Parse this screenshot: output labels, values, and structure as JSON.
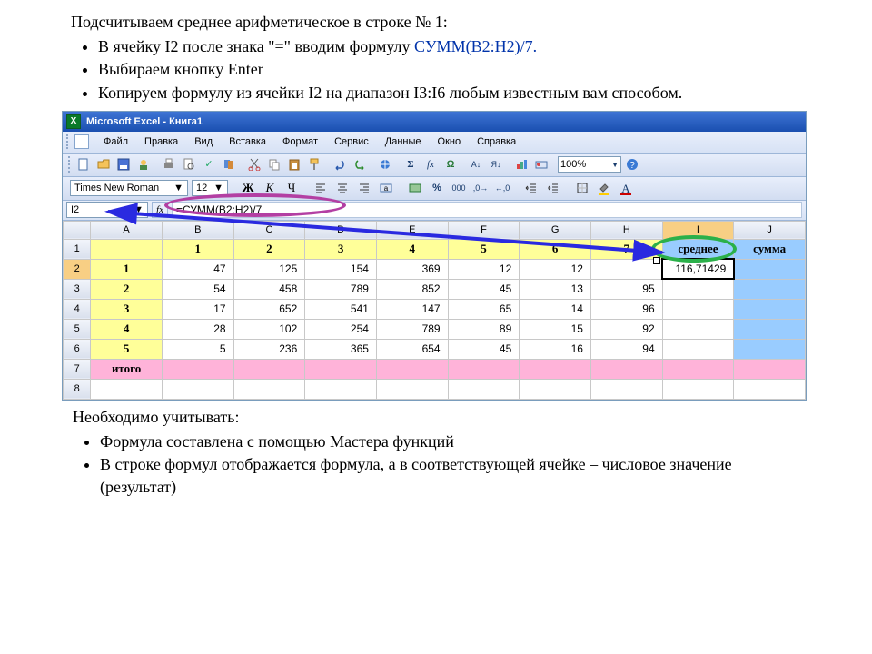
{
  "slide": {
    "heading": "Подсчитываем среднее арифметическое в строке № 1:",
    "bullets": [
      {
        "pre": "В ячейку I2 после знака \"=\" вводим формулу ",
        "formula": "СУММ(B2:H2)/7.",
        "post": ""
      },
      {
        "pre": "Выбираем кнопку Enter",
        "formula": "",
        "post": ""
      },
      {
        "pre": "Копируем формулу из ячейки I2 на диапазон I3:I6 любым известным вам способом.",
        "formula": "",
        "post": ""
      }
    ],
    "notes_heading": "Необходимо учитывать:",
    "notes": [
      "Формула составлена с помощью Мастера функций",
      "В строке формул отображается формула, а в соответствующей ячейке – числовое значение (результат)"
    ]
  },
  "excel": {
    "title": "Microsoft Excel - Книга1",
    "menus": [
      "Файл",
      "Правка",
      "Вид",
      "Вставка",
      "Формат",
      "Сервис",
      "Данные",
      "Окно",
      "Справка"
    ],
    "zoom": "100%",
    "font_name": "Times New Roman",
    "font_size": "12",
    "name_box": "I2",
    "fx_label": "fx",
    "formula": "=СУММ(B2:H2)/7",
    "columns": [
      "A",
      "B",
      "C",
      "D",
      "E",
      "F",
      "G",
      "H",
      "I",
      "J"
    ],
    "header_row": [
      "",
      "1",
      "2",
      "3",
      "4",
      "5",
      "6",
      "7",
      "среднее",
      "сумма"
    ],
    "row_labels_col": [
      "1",
      "2",
      "3",
      "4",
      "5",
      "итого"
    ],
    "data_rows": [
      [
        "47",
        "125",
        "154",
        "369",
        "12",
        "12",
        "116,71429"
      ],
      [
        "54",
        "458",
        "789",
        "852",
        "45",
        "13",
        "95"
      ],
      [
        "17",
        "652",
        "541",
        "147",
        "65",
        "14",
        "96"
      ],
      [
        "28",
        "102",
        "254",
        "789",
        "89",
        "15",
        "92"
      ],
      [
        "5",
        "236",
        "365",
        "654",
        "45",
        "16",
        "94"
      ]
    ],
    "row_numbers": [
      "1",
      "2",
      "3",
      "4",
      "5",
      "6",
      "7",
      "8"
    ]
  }
}
